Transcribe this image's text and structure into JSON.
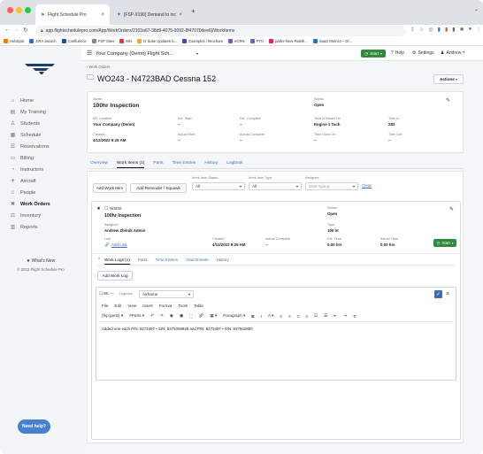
{
  "browser": {
    "tabs": [
      {
        "label": "Flight Schedule Pro",
        "favicon_color": "#3b6fb6"
      },
      {
        "label": "[FSP-9190] Demand to include",
        "favicon_color": "#2d6fd6"
      }
    ],
    "new_tab": "+",
    "url": "app.flightschedulepro.com/App/WorkOrders/2103a67-38d9-4075-9092-8f47070dee6]/WorkItems",
    "bookmarks": [
      "HubSpot",
      "JIRA Search",
      "Confluence",
      "FSP Sites",
      "Mrs",
      "D Suite Updates S...",
      "Examples / Brochure",
      "eCRN",
      "PTO",
      "paths-New-Paleth...",
      "SaaS Metrics – Dr..."
    ]
  },
  "app": {
    "company_select": "Your Company (Demo) Flight Sch...",
    "start_button": "Start",
    "help": "Help",
    "settings": "Settings",
    "user": "Andrew",
    "sidebar": [
      {
        "label": "Home",
        "icon": "home-icon",
        "glyph": "⌂"
      },
      {
        "label": "My Training",
        "icon": "training-icon",
        "glyph": "▤"
      },
      {
        "label": "Students",
        "icon": "students-icon",
        "glyph": "♙"
      },
      {
        "label": "Schedule",
        "icon": "calendar-icon",
        "glyph": "▦"
      },
      {
        "label": "Reservations",
        "icon": "list-icon",
        "glyph": "☰"
      },
      {
        "label": "Billing",
        "icon": "billing-icon",
        "glyph": "▭"
      },
      {
        "label": "Instructors",
        "icon": "instructor-icon",
        "glyph": "◔"
      },
      {
        "label": "Aircraft",
        "icon": "airplane-icon",
        "glyph": "✈"
      },
      {
        "label": "People",
        "icon": "people-icon",
        "glyph": "☺"
      },
      {
        "label": "Work Orders",
        "icon": "wrench-icon",
        "glyph": "✖"
      },
      {
        "label": "Inventory",
        "icon": "inventory-icon",
        "glyph": "⚖"
      },
      {
        "label": "Reports",
        "icon": "reports-icon",
        "glyph": "▥"
      }
    ],
    "whats_new": "What's New",
    "copyright": "© 2022 Flight Schedule Pro",
    "need_help": "Need help?"
  },
  "work_order": {
    "back": "‹ Work Orders",
    "title": "WO243 - N4723BAD Cessna 152",
    "actions": "Actions",
    "name_label": "Name",
    "name": "100hr Inspection",
    "status_label": "Status",
    "status": "Open",
    "fields": [
      {
        "label": "MX Location",
        "value": "Your Company (Demo)"
      },
      {
        "label": "Est. Start",
        "value": "--"
      },
      {
        "label": "Est. Complete",
        "value": "--"
      },
      {
        "label": "Time is Based On",
        "value": "Engine 1 Tach"
      },
      {
        "label": "Time In",
        "value": "283"
      },
      {
        "label": "Created",
        "value": "4/12/2022 9:25 AM"
      },
      {
        "label": "Actual Start",
        "value": "--"
      },
      {
        "label": "Actual Complete",
        "value": "--"
      },
      {
        "label": "Time Done On",
        "value": "--"
      },
      {
        "label": "Time Out",
        "value": "--"
      }
    ],
    "tabs": [
      "Overview",
      "Work Items (1)",
      "Parts",
      "Time Entries",
      "History",
      "Logbook"
    ],
    "active_tab": "Work Items (1)",
    "add_work_item": "Add Work Item",
    "add_reminder": "Add Reminder / Squawk",
    "filter_status_label": "Work Item Status",
    "filter_status": "All",
    "filter_type_label": "Work Item Type",
    "filter_type": "All",
    "assignee_label": "Assignee",
    "assignee_placeholder": "Start typing",
    "clear": "Clear"
  },
  "work_item": {
    "id": "WI230",
    "name": "100hr Inspection",
    "status_label": "Status",
    "status": "Open",
    "assigned_label": "Assigned",
    "assigned": "Andrew Zbitnik Admin",
    "type_label": "Type",
    "type": "100 hr",
    "link_label": "Link",
    "link": "Add Link",
    "created_label": "Created",
    "created": "4/12/2022 9:26 AM",
    "actual_complete_label": "Actual Complete",
    "actual_complete": "--",
    "est_time_label": "Est. Time",
    "est_time": "0.00 hrs",
    "actual_time_label": "Actual Time",
    "actual_time": "0.00 hrs",
    "start": "Start",
    "tabs": [
      "Work Logs (1)",
      "Parts",
      "Time Entries",
      "Attachments",
      "History"
    ],
    "add_work_log": "Add Work Log"
  },
  "editor": {
    "prefix": "WL ---",
    "logbook_label": "Logbook",
    "logbook": "Airframe",
    "menu": [
      "File",
      "Edit",
      "View",
      "Insert",
      "Format",
      "Tools",
      "Table"
    ],
    "toolbar_tag": "{fsp:parts}",
    "toolbar_parts": "#Parts",
    "paragraph": "Paragraph",
    "text": "Added one each P/N: 8273497 • S/N: 8375406928 and P/N: 8273497 • S/N: 837562850"
  },
  "colors": {
    "accent": "#3a6fb5",
    "green": "#2e8b3d",
    "badge_blue": "#5b9bd5"
  }
}
